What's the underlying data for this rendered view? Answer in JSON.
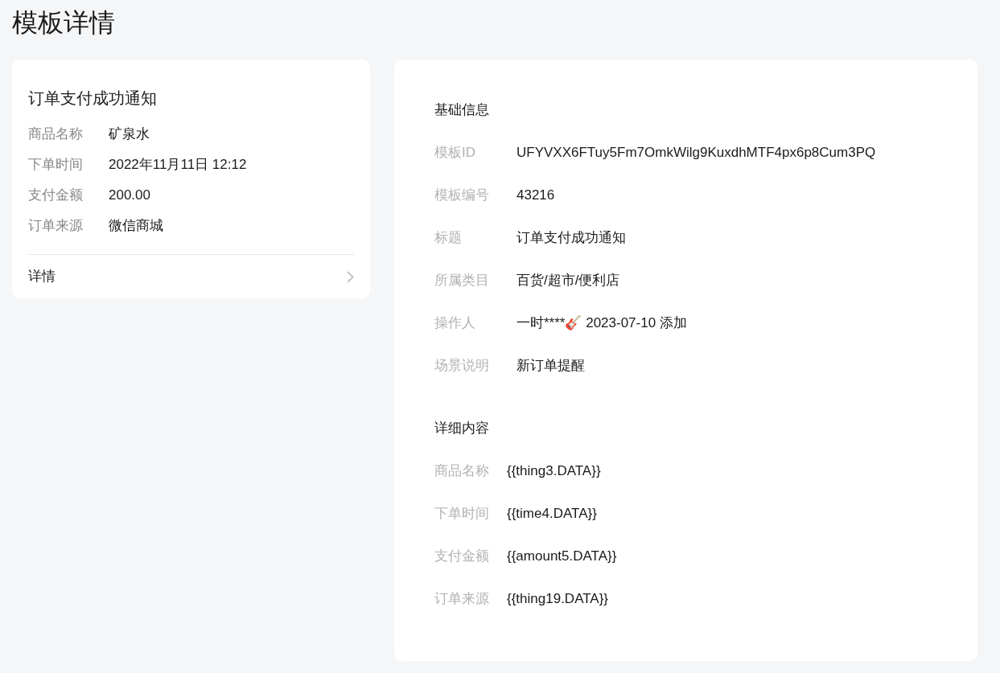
{
  "page_title": "模板详情",
  "preview": {
    "title": "订单支付成功通知",
    "fields": [
      {
        "label": "商品名称",
        "value": "矿泉水"
      },
      {
        "label": "下单时间",
        "value": "2022年11月11日 12:12"
      },
      {
        "label": "支付金额",
        "value": "200.00"
      },
      {
        "label": "订单来源",
        "value": "微信商城"
      }
    ],
    "link": "详情"
  },
  "basic_info": {
    "heading": "基础信息",
    "fields": [
      {
        "label": "模板ID",
        "value": "UFYVXX6FTuy5Fm7OmkWilg9KuxdhMTF4px6p8Cum3PQ"
      },
      {
        "label": "模板编号",
        "value": "43216"
      },
      {
        "label": "标题",
        "value": "订单支付成功通知"
      },
      {
        "label": "所属类目",
        "value": "百货/超市/便利店"
      },
      {
        "label": "操作人",
        "value": "一时****🎸 2023-07-10 添加"
      },
      {
        "label": "场景说明",
        "value": "新订单提醒"
      }
    ]
  },
  "detail_content": {
    "heading": "详细内容",
    "fields": [
      {
        "label": "商品名称",
        "value": "{{thing3.DATA}}"
      },
      {
        "label": "下单时间",
        "value": "{{time4.DATA}}"
      },
      {
        "label": "支付金额",
        "value": "{{amount5.DATA}}"
      },
      {
        "label": "订单来源",
        "value": "{{thing19.DATA}}"
      }
    ]
  }
}
